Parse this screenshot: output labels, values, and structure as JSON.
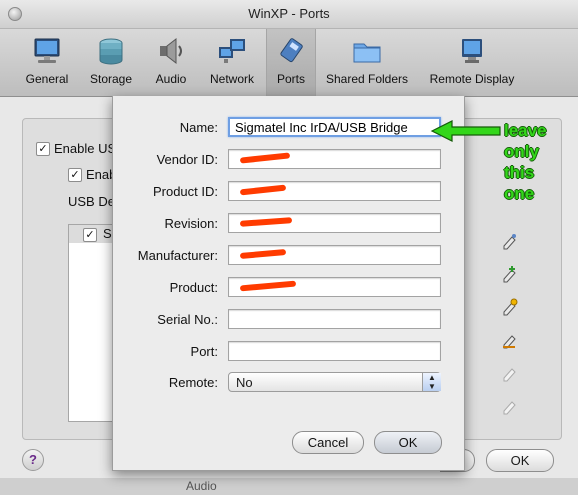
{
  "window": {
    "title": "WinXP - Ports"
  },
  "toolbar": {
    "items": [
      {
        "label": "General",
        "icon": "monitor-icon"
      },
      {
        "label": "Storage",
        "icon": "disks-icon"
      },
      {
        "label": "Audio",
        "icon": "speaker-icon"
      },
      {
        "label": "Network",
        "icon": "network-icon"
      },
      {
        "label": "Ports",
        "icon": "ports-icon",
        "selected": true
      },
      {
        "label": "Shared Folders",
        "icon": "folder-icon"
      },
      {
        "label": "Remote Display",
        "icon": "display-icon"
      }
    ]
  },
  "background": {
    "enable_usb_label": "Enable US",
    "enable_ehci_label": "Enab",
    "device_filters_label": "USB De",
    "filter_item": "Si",
    "help_label": "?",
    "ok_label": "OK",
    "section_ghost": "Audio"
  },
  "dialog": {
    "fields": [
      {
        "label": "Name:",
        "value": "Sigmatel Inc IrDA/USB Bridge",
        "redacted": false
      },
      {
        "label": "Vendor ID:",
        "value": "",
        "redacted": true
      },
      {
        "label": "Product ID:",
        "value": "",
        "redacted": true
      },
      {
        "label": "Revision:",
        "value": "",
        "redacted": true
      },
      {
        "label": "Manufacturer:",
        "value": "",
        "redacted": true
      },
      {
        "label": "Product:",
        "value": "",
        "redacted": true
      },
      {
        "label": "Serial No.:",
        "value": "",
        "redacted": false
      },
      {
        "label": "Port:",
        "value": "",
        "redacted": false
      }
    ],
    "remote": {
      "label": "Remote:",
      "value": "No"
    },
    "cancel_label": "Cancel",
    "ok_label": "OK"
  },
  "annotation": {
    "lines": [
      "leave",
      "only",
      "this",
      "one"
    ],
    "color": "#33d61a",
    "redaction_color": "#ff3b00"
  }
}
